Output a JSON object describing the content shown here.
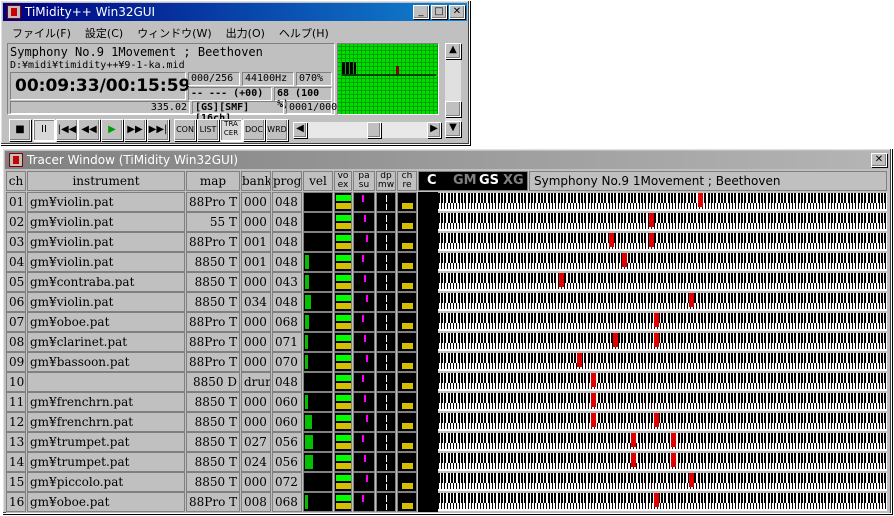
{
  "main_window": {
    "title": "TiMidity++ Win32GUI",
    "menu": [
      "ファイル(F)",
      "設定(C)",
      "ウィンドウ(W)",
      "出力(O)",
      "ヘルプ(H)"
    ],
    "song_title": "Symphony No.9 1Movement ; Beethoven",
    "file_path": "D:¥midi¥timidity++¥9-1-ka.mid",
    "time": "00:09:33/00:15:59",
    "voices": "000/256",
    "sample_rate": "44100Hz",
    "amp": "070%",
    "key": "-- --- (+00)",
    "tempo": "68 (100 %)",
    "pos_value": "335.02",
    "modes": "[GS][SMF][16ch]",
    "track": "0001/0002",
    "buttons": {
      "stop": "■",
      "pause": "II",
      "first": "|◀◀",
      "rewind": "◀◀",
      "play": "▶",
      "ffwd": "▶▶",
      "last": "▶▶|",
      "con": "CON",
      "list": "LIST",
      "tracer": "TRA CER",
      "doc": "DOC",
      "wrd": "WRD"
    }
  },
  "tracer": {
    "title": "Tracer Window (TiMidity Win32GUI)",
    "headers": {
      "ch": "ch",
      "instrument": "instrument",
      "map": "map",
      "bank": "bank",
      "prog": "prog",
      "vel": "vel",
      "vo": "vo",
      "ex": "ex",
      "pa": "pa",
      "su": "su",
      "dp": "dp",
      "mw": "mw",
      "ch2": "ch",
      "re": "re"
    },
    "modes": [
      "C",
      "GM",
      "GS",
      "XG"
    ],
    "song_title": "Symphony No.9 1Movement ; Beethoven",
    "rows": [
      {
        "ch": "01",
        "instrument": "gm¥violin.pat",
        "map": "88Pro T",
        "bank": "000",
        "prog": "048"
      },
      {
        "ch": "02",
        "instrument": "gm¥violin.pat",
        "map": "55 T",
        "bank": "000",
        "prog": "048"
      },
      {
        "ch": "03",
        "instrument": "gm¥violin.pat",
        "map": "88Pro T",
        "bank": "001",
        "prog": "048"
      },
      {
        "ch": "04",
        "instrument": "gm¥violin.pat",
        "map": "8850 T",
        "bank": "001",
        "prog": "048"
      },
      {
        "ch": "05",
        "instrument": "gm¥contraba.pat",
        "map": "8850 T",
        "bank": "000",
        "prog": "043"
      },
      {
        "ch": "06",
        "instrument": "gm¥violin.pat",
        "map": "8850 T",
        "bank": "034",
        "prog": "048"
      },
      {
        "ch": "07",
        "instrument": "gm¥oboe.pat",
        "map": "88Pro T",
        "bank": "000",
        "prog": "068"
      },
      {
        "ch": "08",
        "instrument": "gm¥clarinet.pat",
        "map": "88Pro T",
        "bank": "000",
        "prog": "071"
      },
      {
        "ch": "09",
        "instrument": "gm¥bassoon.pat",
        "map": "88Pro T",
        "bank": "000",
        "prog": "070"
      },
      {
        "ch": "10",
        "instrument": "",
        "map": "8850 D",
        "bank": "drum",
        "prog": "048"
      },
      {
        "ch": "11",
        "instrument": "gm¥frenchrn.pat",
        "map": "8850 T",
        "bank": "000",
        "prog": "060"
      },
      {
        "ch": "12",
        "instrument": "gm¥frenchrn.pat",
        "map": "8850 T",
        "bank": "000",
        "prog": "060"
      },
      {
        "ch": "13",
        "instrument": "gm¥trumpet.pat",
        "map": "8850 T",
        "bank": "027",
        "prog": "056"
      },
      {
        "ch": "14",
        "instrument": "gm¥trumpet.pat",
        "map": "8850 T",
        "bank": "024",
        "prog": "056"
      },
      {
        "ch": "15",
        "instrument": "gm¥piccolo.pat",
        "map": "8850 T",
        "bank": "000",
        "prog": "072"
      },
      {
        "ch": "16",
        "instrument": "gm¥oboe.pat",
        "map": "88Pro T",
        "bank": "008",
        "prog": "068"
      }
    ],
    "vel_levels": [
      0,
      0,
      0,
      0.3,
      0.3,
      0.4,
      0.3,
      0.2,
      0.2,
      0,
      0.2,
      0.5,
      0.6,
      0.6,
      0,
      0.2
    ],
    "notes": [
      [
        0.58
      ],
      [
        0.47
      ],
      [
        0.38,
        0.47
      ],
      [
        0.41
      ],
      [
        0.27
      ],
      [
        0.56
      ],
      [
        0.48
      ],
      [
        0.39,
        0.48
      ],
      [
        0.31
      ],
      [
        0.34
      ],
      [
        0.34
      ],
      [
        0.34,
        0.48
      ],
      [
        0.43,
        0.52
      ],
      [
        0.43,
        0.52
      ],
      [
        0.56
      ],
      [
        0.48
      ]
    ],
    "colors": {
      "vel": "#00c000",
      "vo": "#00ff00",
      "ex": "#d4c000",
      "pa": "#ff00ff",
      "note": "#e00000"
    }
  }
}
